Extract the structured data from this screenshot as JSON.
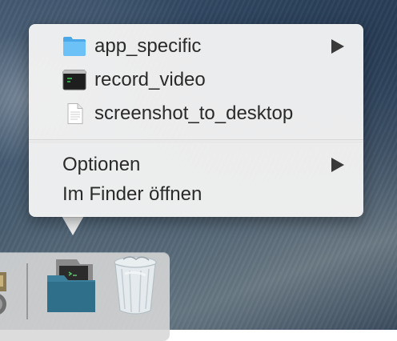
{
  "context_menu": {
    "items": [
      {
        "label": "app_specific",
        "icon": "folder-icon",
        "has_submenu": true
      },
      {
        "label": "record_video",
        "icon": "terminal-executable-icon",
        "has_submenu": false
      },
      {
        "label": "screenshot_to_desktop",
        "icon": "document-icon",
        "has_submenu": false
      }
    ],
    "options_label": "Optionen",
    "open_in_finder_label": "Im Finder öffnen"
  },
  "dock": {
    "items": [
      {
        "icon": "partial-app-icon"
      },
      {
        "icon": "scripts-folder-stack-icon"
      },
      {
        "icon": "trash-icon"
      }
    ]
  },
  "colors": {
    "menu_background": "#f2f2f2",
    "folder_blue": "#5fb8f3",
    "dock_folder": "#2f6f8a"
  }
}
